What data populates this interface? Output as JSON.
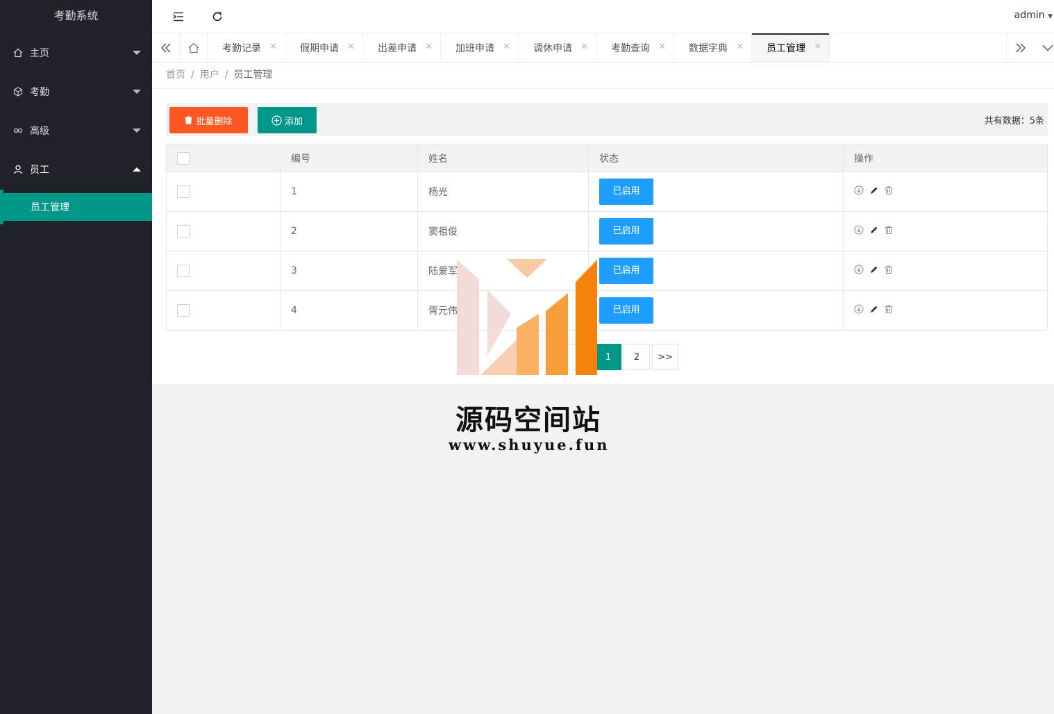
{
  "sidebar": {
    "logo": "考勤系统",
    "items": [
      {
        "label": "主页",
        "icon": "home-icon"
      },
      {
        "label": "考勤",
        "icon": "cube-icon"
      },
      {
        "label": "高级",
        "icon": "senior-icon"
      },
      {
        "label": "员工",
        "icon": "user-icon"
      }
    ],
    "sub_items": [
      {
        "label": "员工管理"
      }
    ]
  },
  "header": {
    "user": "admin"
  },
  "tabs": [
    {
      "label": "考勤记录"
    },
    {
      "label": "假期申请"
    },
    {
      "label": "出差申请"
    },
    {
      "label": "加班申请"
    },
    {
      "label": "调休申请"
    },
    {
      "label": "考勤查询"
    },
    {
      "label": "数据字典"
    },
    {
      "label": "员工管理",
      "active": true
    }
  ],
  "breadcrumb": {
    "home": "首页",
    "parent": "用户",
    "current": "员工管理"
  },
  "toolbar": {
    "delete_label": "批量删除",
    "add_label": "添加",
    "total": "共有数据：5条"
  },
  "table": {
    "headers": [
      "编号",
      "姓名",
      "状态",
      "操作"
    ],
    "rows": [
      {
        "id": "1",
        "name": "杨光",
        "status": "已启用"
      },
      {
        "id": "2",
        "name": "窦祖俊",
        "status": "已启用"
      },
      {
        "id": "3",
        "name": "陆爱军",
        "status": "已启用"
      },
      {
        "id": "4",
        "name": "胥元伟",
        "status": "已启用"
      }
    ]
  },
  "pager": {
    "prev": "<",
    "current": "1",
    "next_page": "2",
    "next": ">>"
  },
  "watermark": {
    "title": "源码空间站",
    "url": "www.shuyue.fun"
  },
  "colors": {
    "sidebar": "#20222a",
    "accent": "#009688",
    "danger": "#ff5722",
    "status": "#1e9fff"
  }
}
